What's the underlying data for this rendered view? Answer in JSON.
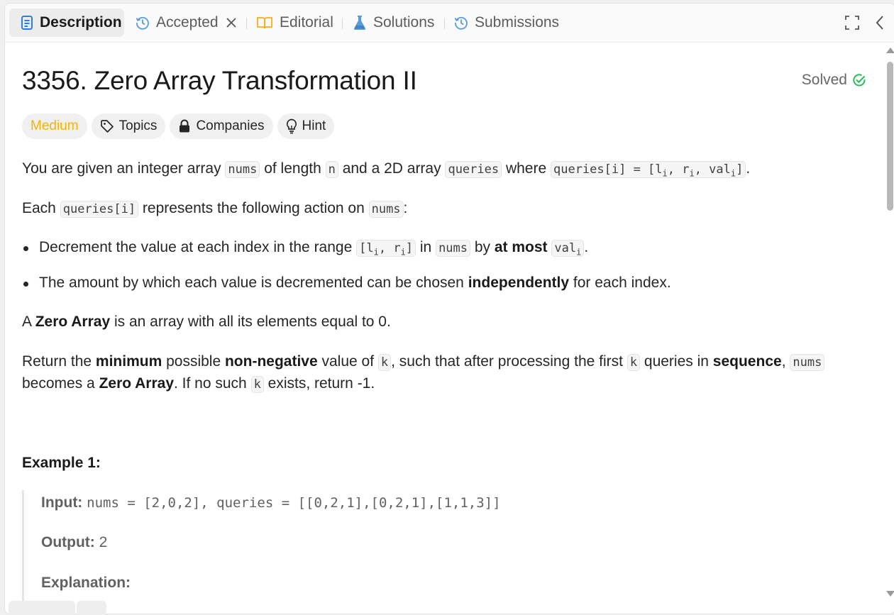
{
  "tabs": [
    {
      "label": "Description",
      "icon": "document-icon",
      "active": true
    },
    {
      "label": "Accepted",
      "icon": "history-icon",
      "closable": true
    },
    {
      "label": "Editorial",
      "icon": "book-icon"
    },
    {
      "label": "Solutions",
      "icon": "flask-icon"
    },
    {
      "label": "Submissions",
      "icon": "history-icon"
    }
  ],
  "problem": {
    "title": "3356. Zero Array Transformation II",
    "status": "Solved",
    "difficulty": "Medium",
    "chips": {
      "topics": "Topics",
      "companies": "Companies",
      "hint": "Hint"
    }
  },
  "description": {
    "p1": {
      "t1": "You are given an integer array ",
      "c1": "nums",
      "t2": " of length ",
      "c2": "n",
      "t3": " and a 2D array ",
      "c3": "queries",
      "t4": " where ",
      "c4a": "queries[i] = [l",
      "c4s1": "i",
      "c4b": ", r",
      "c4s2": "i",
      "c4c": ", val",
      "c4s3": "i",
      "c4d": "]",
      "t5": "."
    },
    "p2": {
      "t1": "Each ",
      "c1": "queries[i]",
      "t2": " represents the following action on ",
      "c2": "nums",
      "t3": ":"
    },
    "bullet1": {
      "t1": "Decrement the value at each index in the range ",
      "c1a": "[l",
      "c1s1": "i",
      "c1b": ", r",
      "c1s2": "i",
      "c1c": "]",
      "t2": " in ",
      "c2": "nums",
      "t3": " by ",
      "b1": "at most",
      "t4": " ",
      "c3a": "val",
      "c3s": "i",
      "t5": "."
    },
    "bullet2": {
      "t1": "The amount by which each value is decremented can be chosen ",
      "b1": "independently",
      "t2": " for each index."
    },
    "p3": {
      "t1": "A ",
      "b1": "Zero Array",
      "t2": " is an array with all its elements equal to 0."
    },
    "p4": {
      "t1": "Return the ",
      "b1": "minimum",
      "t2": " possible ",
      "b2": "non-negative",
      "t3": " value of ",
      "c1": "k",
      "t4": ", such that after processing the first ",
      "c2": "k",
      "t5": " queries in ",
      "b3": "sequence",
      "t6": ", ",
      "c3": "nums"
    },
    "p5": {
      "t1": "becomes a ",
      "b1": "Zero Array",
      "t2": ". If no such ",
      "c1": "k",
      "t3": " exists, return -1."
    }
  },
  "example1": {
    "title": "Example 1:",
    "input_label": "Input:",
    "input_value": "nums = [2,0,2], queries = [[0,2,1],[0,2,1],[1,1,3]]",
    "output_label": "Output:",
    "output_value": "2",
    "explanation_label": "Explanation:"
  }
}
